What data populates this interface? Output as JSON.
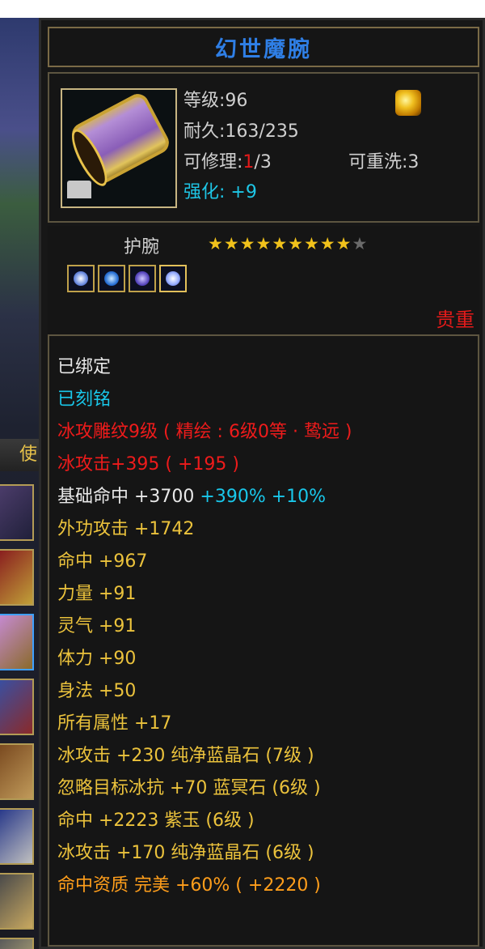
{
  "item": {
    "name": "幻世魔腕",
    "level_text": "等级:96",
    "durability_text": "耐久:163/235",
    "repair_prefix": "可修理:",
    "repair_current": "1",
    "repair_suffix": "/3",
    "rewash_text": "可重洗:3",
    "strengthen_text": "强化: +9",
    "type": "护腕",
    "stars_filled": 9,
    "stars_total": 10,
    "gem_icons": [
      "white-blue-gem-icon",
      "blue-gem-icon",
      "purple-gem-icon",
      "white-gem-icon"
    ],
    "precious_text": "贵重"
  },
  "attributes": {
    "bound": "已绑定",
    "engraved": "已刻铭",
    "engrave_detail": "冰攻雕纹9级 ( 精绘 : 6级0等 · 鸷远 )",
    "ice_attack": "冰攻击+395 ( +195 )",
    "base_hit_label": "基础命中 +3700",
    "base_hit_bonus": "+390% +10%",
    "ext_attack": "外功攻击 +1742",
    "hit": "命中 +967",
    "strength": "力量 +91",
    "spirit": "灵气 +91",
    "stamina": "体力 +90",
    "agility": "身法 +50",
    "all_attr": "所有属性 +17",
    "gem1": "冰攻击 +230 纯净蓝晶石 (7级 )",
    "gem2": "忽略目标冰抗 +70 蓝冥石 (6级 )",
    "gem3": "命中 +2223 紫玉 (6级 )",
    "gem4": "冰攻击 +170 纯净蓝晶石 (6级 )",
    "aptitude": "命中资质  完美 +60% ( +2220 )"
  },
  "colors": {
    "title": "#2f7fe6",
    "white": "#e8e8e8",
    "cyan": "#19c7ea",
    "red": "#ee1b1b",
    "gold": "#ebc23c",
    "orange": "#ff9e1b"
  }
}
